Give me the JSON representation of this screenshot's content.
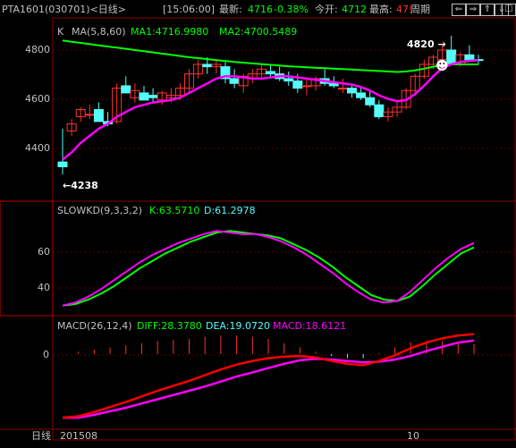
{
  "header": {
    "symbol": "PTA1601",
    "code_period": "(030701)<日线>",
    "time": "[15:06:00]",
    "latest_label": "最新:",
    "latest_value": "4716",
    "change_pct": "-0.38%",
    "open_label": "今开:",
    "open_value": "4712",
    "high_label": "最高:",
    "high_value": "47!",
    "cycle_button": "周期",
    "nav_buttons": [
      "left-arrow-icon",
      "right-arrow-icon",
      "up-arrow-icon",
      "down-arrow-icon",
      "close-icon"
    ]
  },
  "colors": {
    "up": "#ff3232",
    "down": "#54fcfc",
    "ma5": "#ffffff",
    "ma1": "#ff00ff",
    "ma2": "#00ff00",
    "ma3": "#ff0000",
    "grid": "#8b0000",
    "axis": "#c0c0c0",
    "accent_yellow": "#ffff54",
    "cyan": "#54fcfc",
    "orange": "#ff8000"
  },
  "kline": {
    "indicator_label": "K",
    "ma_label": "MA(5,8,60)",
    "ma1_label": "MA1:4716.9980",
    "ma2_label": "MA2:4700.5489",
    "y_ticks": [
      "4800",
      "4600",
      "4400"
    ],
    "high_marker": "4820",
    "low_marker": "4238",
    "smiley": "☻"
  },
  "kd": {
    "label": "SLOWKD(9,3,3,2)",
    "k_label": "K:63.5710",
    "d_label": "D:61.2978",
    "y_ticks": [
      "60",
      "40"
    ]
  },
  "macd": {
    "label": "MACD(26,12,4)",
    "diff_label": "DIFF:28.3780",
    "dea_label": "DEA:19.0720",
    "macd_label": "MACD:18.6121",
    "y_ticks": [
      "0"
    ]
  },
  "xaxis": {
    "label": "日线",
    "ticks": [
      "201508",
      "10"
    ]
  },
  "chart_data": [
    {
      "type": "candlestick",
      "ohlc": [
        [
          4290,
          4430,
          4238,
          4270
        ],
        [
          4420,
          4470,
          4400,
          4450
        ],
        [
          4480,
          4520,
          4460,
          4510
        ],
        [
          4490,
          4530,
          4470,
          4490
        ],
        [
          4510,
          4540,
          4480,
          4460
        ],
        [
          4460,
          4500,
          4440,
          4450
        ],
        [
          4460,
          4620,
          4450,
          4600
        ],
        [
          4610,
          4650,
          4590,
          4580
        ],
        [
          4560,
          4620,
          4540,
          4590
        ],
        [
          4580,
          4610,
          4560,
          4550
        ],
        [
          4570,
          4600,
          4540,
          4560
        ],
        [
          4550,
          4590,
          4530,
          4580
        ],
        [
          4560,
          4600,
          4540,
          4570
        ],
        [
          4570,
          4620,
          4550,
          4600
        ],
        [
          4600,
          4680,
          4580,
          4660
        ],
        [
          4660,
          4720,
          4640,
          4700
        ],
        [
          4700,
          4730,
          4660,
          4690
        ],
        [
          4690,
          4720,
          4660,
          4700
        ],
        [
          4690,
          4710,
          4620,
          4640
        ],
        [
          4640,
          4680,
          4600,
          4620
        ],
        [
          4610,
          4660,
          4580,
          4650
        ],
        [
          4640,
          4680,
          4620,
          4660
        ],
        [
          4660,
          4700,
          4640,
          4680
        ],
        [
          4670,
          4700,
          4640,
          4660
        ],
        [
          4660,
          4690,
          4630,
          4640
        ],
        [
          4640,
          4670,
          4610,
          4630
        ],
        [
          4630,
          4660,
          4580,
          4600
        ],
        [
          4610,
          4640,
          4570,
          4610
        ],
        [
          4610,
          4650,
          4590,
          4640
        ],
        [
          4640,
          4680,
          4610,
          4620
        ],
        [
          4620,
          4650,
          4600,
          4610
        ],
        [
          4600,
          4640,
          4580,
          4600
        ],
        [
          4600,
          4620,
          4560,
          4580
        ],
        [
          4580,
          4610,
          4550,
          4560
        ],
        [
          4560,
          4590,
          4520,
          4530
        ],
        [
          4530,
          4550,
          4470,
          4480
        ],
        [
          4480,
          4520,
          4460,
          4500
        ],
        [
          4500,
          4540,
          4480,
          4520
        ],
        [
          4520,
          4600,
          4510,
          4590
        ],
        [
          4590,
          4660,
          4570,
          4650
        ],
        [
          4650,
          4720,
          4640,
          4700
        ],
        [
          4700,
          4740,
          4680,
          4730
        ],
        [
          4720,
          4780,
          4700,
          4760
        ],
        [
          4760,
          4820,
          4740,
          4700
        ],
        [
          4700,
          4750,
          4690,
          4740
        ],
        [
          4740,
          4780,
          4720,
          4720
        ],
        [
          4720,
          4740,
          4700,
          4716
        ]
      ],
      "ma1": [
        4300,
        4330,
        4370,
        4400,
        4430,
        4450,
        4480,
        4500,
        4520,
        4530,
        4540,
        4545,
        4550,
        4560,
        4580,
        4600,
        4620,
        4640,
        4650,
        4650,
        4645,
        4640,
        4640,
        4645,
        4650,
        4650,
        4645,
        4640,
        4635,
        4630,
        4625,
        4620,
        4615,
        4605,
        4590,
        4570,
        4555,
        4545,
        4550,
        4575,
        4610,
        4650,
        4685,
        4700,
        4710,
        4715,
        4717
      ],
      "ma2": [
        4800,
        4795,
        4790,
        4785,
        4780,
        4775,
        4770,
        4765,
        4760,
        4755,
        4750,
        4745,
        4740,
        4735,
        4730,
        4726,
        4722,
        4718,
        4714,
        4710,
        4707,
        4704,
        4701,
        4698,
        4695,
        4692,
        4690,
        4688,
        4686,
        4684,
        4682,
        4680,
        4678,
        4676,
        4674,
        4672,
        4670,
        4668,
        4670,
        4675,
        4682,
        4690,
        4696,
        4700,
        4700,
        4700,
        4700
      ],
      "ylim": [
        4238,
        4820
      ]
    },
    {
      "type": "line",
      "series": [
        {
          "name": "K",
          "values": [
            22,
            24,
            28,
            33,
            39,
            45,
            51,
            56,
            60,
            64,
            67,
            70,
            72,
            71,
            70,
            70,
            68,
            65,
            61,
            56,
            50,
            44,
            37,
            31,
            26,
            24,
            25,
            31,
            39,
            47,
            54,
            60,
            64
          ]
        },
        {
          "name": "D",
          "values": [
            22,
            23,
            26,
            30,
            35,
            41,
            47,
            52,
            57,
            61,
            65,
            68,
            71,
            72,
            71,
            70,
            69,
            67,
            63,
            59,
            54,
            48,
            41,
            35,
            29,
            26,
            25,
            28,
            35,
            43,
            50,
            57,
            61
          ]
        }
      ],
      "ylim": [
        20,
        80
      ]
    },
    {
      "type": "line",
      "series": [
        {
          "name": "DIFF",
          "values": [
            -90,
            -88,
            -82,
            -75,
            -68,
            -60,
            -52,
            -45,
            -38,
            -30,
            -22,
            -15,
            -10,
            -6,
            -4,
            -3,
            -5,
            -10,
            -14,
            -16,
            -10,
            -2,
            8,
            16,
            22,
            26,
            28
          ]
        },
        {
          "name": "DEA",
          "values": [
            -90,
            -90,
            -86,
            -81,
            -76,
            -70,
            -64,
            -58,
            -52,
            -46,
            -39,
            -32,
            -26,
            -20,
            -14,
            -9,
            -7,
            -8,
            -10,
            -12,
            -11,
            -8,
            -3,
            4,
            10,
            16,
            19
          ]
        }
      ],
      "ylim": [
        -100,
        30
      ]
    }
  ]
}
